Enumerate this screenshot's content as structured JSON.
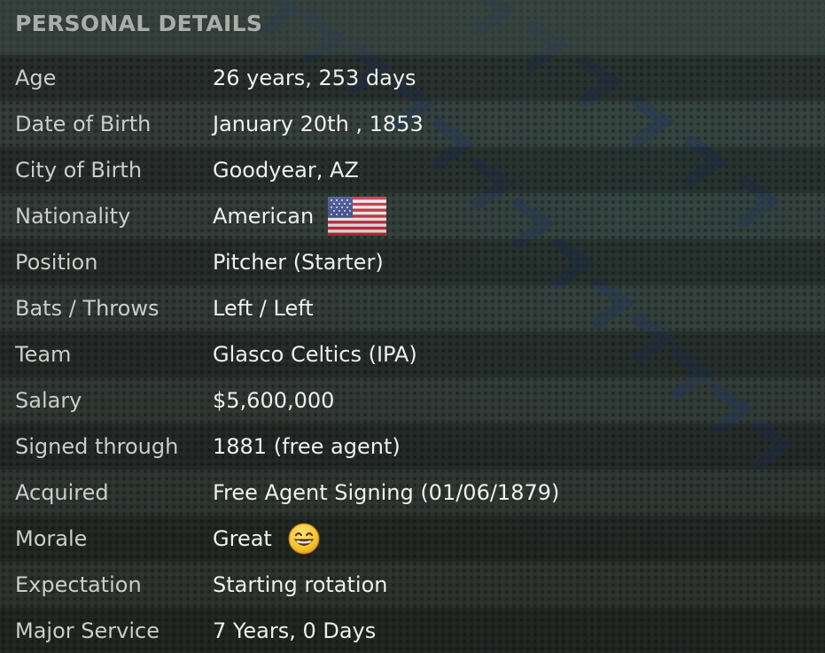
{
  "header": {
    "title": "PERSONAL DETAILS"
  },
  "rows": [
    {
      "label": "Age",
      "value": "26 years, 253 days"
    },
    {
      "label": "Date of Birth",
      "value": "January 20th , 1853"
    },
    {
      "label": "City of Birth",
      "value": "Goodyear, AZ"
    },
    {
      "label": "Nationality",
      "value": "American",
      "icon": "us-flag-icon"
    },
    {
      "label": "Position",
      "value": "Pitcher (Starter)"
    },
    {
      "label": "Bats / Throws",
      "value": "Left / Left"
    },
    {
      "label": "Team",
      "value": "Glasco Celtics (IPA)"
    },
    {
      "label": "Salary",
      "value": "$5,600,000"
    },
    {
      "label": "Signed through",
      "value": "1881 (free agent)"
    },
    {
      "label": "Acquired",
      "value": "Free Agent Signing (01/06/1879)"
    },
    {
      "label": "Morale",
      "value": "Great",
      "icon": "grinning-face-icon"
    },
    {
      "label": "Expectation",
      "value": "Starting rotation"
    },
    {
      "label": "Major Service",
      "value": "7 Years, 0 Days"
    }
  ],
  "colors": {
    "label_text": "#c9cecb",
    "value_text": "#eef0ee",
    "header_text": "#a9aeab",
    "stitch": "#2c3f5e"
  }
}
